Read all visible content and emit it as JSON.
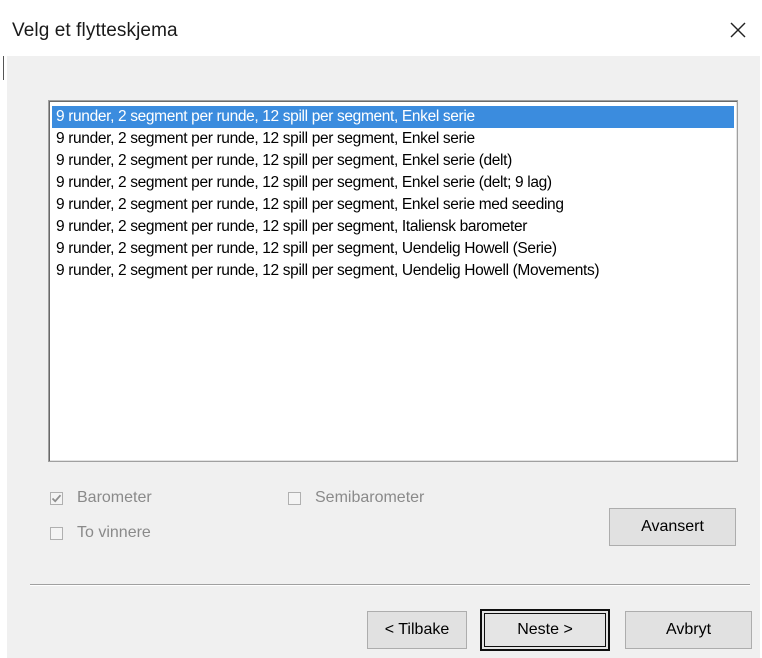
{
  "window": {
    "title": "Velg et flytteskjema",
    "close_icon": "close-icon"
  },
  "movement_list": {
    "selected_index": 0,
    "items": [
      "9 runder, 2 segment per runde, 12 spill per segment, Enkel serie",
      "9 runder, 2 segment per runde, 12 spill per segment, Enkel serie",
      "9 runder, 2 segment per runde, 12 spill per segment, Enkel serie (delt)",
      "9 runder, 2 segment per runde, 12 spill per segment, Enkel serie (delt; 9 lag)",
      "9 runder, 2 segment per runde, 12 spill per segment, Enkel serie med seeding",
      "9 runder, 2 segment per runde, 12 spill per segment, Italiensk barometer",
      "9 runder, 2 segment per runde, 12 spill per segment, Uendelig Howell (Serie)",
      "9 runder, 2 segment per runde, 12 spill per segment, Uendelig Howell (Movements)"
    ]
  },
  "options": {
    "barometer": {
      "label": "Barometer",
      "checked": true,
      "enabled": false
    },
    "semibarometer": {
      "label": "Semibarometer",
      "checked": false,
      "enabled": false
    },
    "to_vinnere": {
      "label": "To vinnere",
      "checked": false,
      "enabled": false
    }
  },
  "buttons": {
    "advanced": "Avansert",
    "back": "< Tilbake",
    "next": "Neste >",
    "cancel": "Avbryt"
  },
  "colors": {
    "selection": "#3b8cde",
    "dialog_bg": "#f0f0f0",
    "disabled_text": "#8a8a8a"
  }
}
